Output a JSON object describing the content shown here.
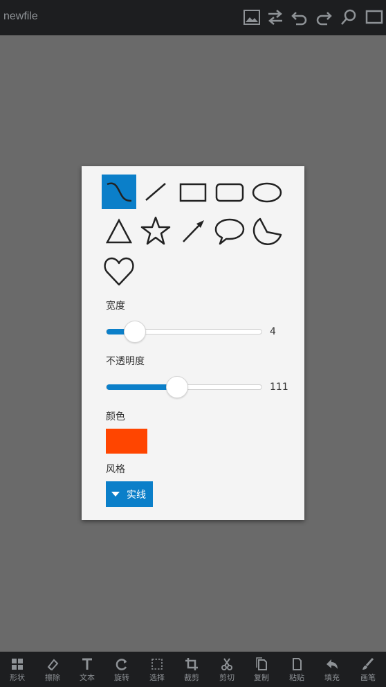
{
  "app": {
    "title": "newfile"
  },
  "top_icons": [
    "image-icon",
    "swap-icon",
    "undo-icon",
    "redo-icon",
    "zoom-icon",
    "fullscreen-icon"
  ],
  "panel": {
    "shapes": [
      "curve",
      "line",
      "rectangle",
      "rounded-rectangle",
      "ellipse",
      "triangle",
      "star",
      "arrow",
      "speech-bubble",
      "pie",
      "heart"
    ],
    "selected_shape": "curve",
    "width": {
      "label": "宽度",
      "value": "4",
      "fraction": 0.18
    },
    "opacity": {
      "label": "不透明度",
      "value": "111",
      "fraction": 0.45
    },
    "color": {
      "label": "颜色",
      "value": "#ff4500"
    },
    "style": {
      "label": "风格",
      "selected": "实线"
    }
  },
  "toolbar": {
    "items": [
      {
        "label": "形状",
        "icon": "shapes-icon"
      },
      {
        "label": "擦除",
        "icon": "eraser-icon"
      },
      {
        "label": "文本",
        "icon": "text-icon"
      },
      {
        "label": "旋转",
        "icon": "rotate-icon"
      },
      {
        "label": "选择",
        "icon": "select-icon"
      },
      {
        "label": "裁剪",
        "icon": "crop-icon"
      },
      {
        "label": "剪切",
        "icon": "scissors-icon"
      },
      {
        "label": "复制",
        "icon": "copy-icon"
      },
      {
        "label": "粘贴",
        "icon": "paste-icon"
      },
      {
        "label": "填充",
        "icon": "fill-icon"
      },
      {
        "label": "画笔",
        "icon": "brush-icon"
      }
    ]
  },
  "colors": {
    "accent": "#0b7fc9",
    "bar": "#1d1e20",
    "canvas": "#6a6a6a",
    "panel": "#f4f4f4"
  }
}
